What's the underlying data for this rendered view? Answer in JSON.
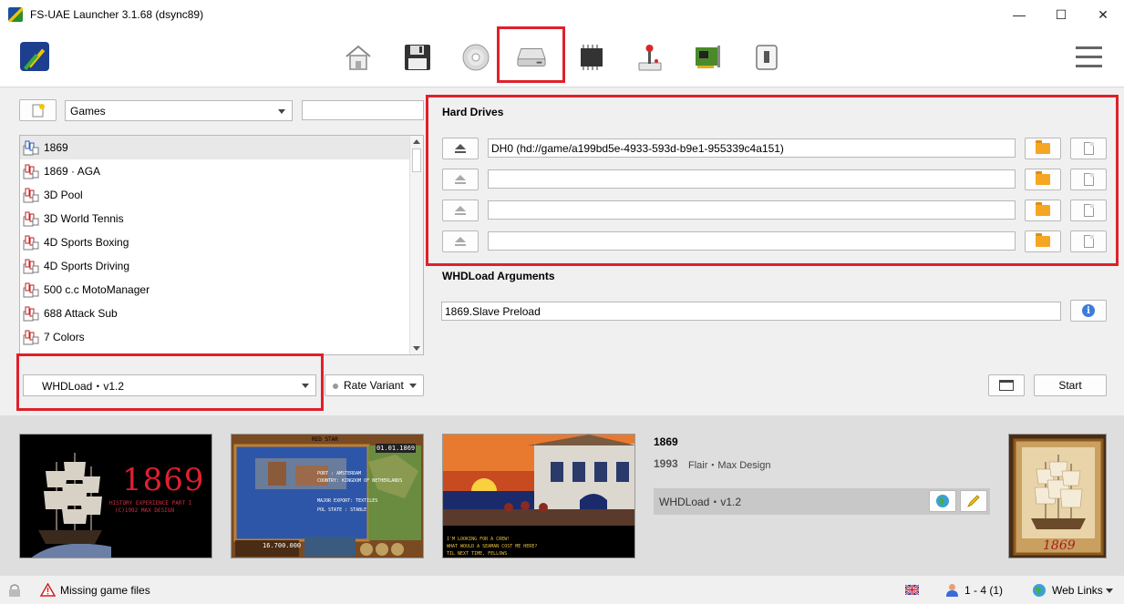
{
  "window": {
    "title": "FS-UAE Launcher 3.1.68 (dsync89)",
    "controls": {
      "minimize": "—",
      "maximize": "☐",
      "close": "✕"
    }
  },
  "toolbar": {
    "tabs": [
      {
        "name": "home-icon"
      },
      {
        "name": "floppy-icon"
      },
      {
        "name": "cdrom-icon"
      },
      {
        "name": "hard-drive-icon",
        "active": true
      },
      {
        "name": "memory-chip-icon"
      },
      {
        "name": "joystick-icon"
      },
      {
        "name": "expansion-card-icon"
      },
      {
        "name": "switch-icon"
      }
    ],
    "menu_icon": "hamburger-menu-icon"
  },
  "left": {
    "database_select": "Games",
    "search_value": "",
    "games": [
      "1869",
      "1869 · AGA",
      "3D Pool",
      "3D World Tennis",
      "4D Sports Boxing",
      "4D Sports Driving",
      "500 c.c MotoManager",
      "688 Attack Sub",
      "7 Colors"
    ],
    "selected_index": 0,
    "variant_select": "WHDLoad・v1.2",
    "rate_variant": "Rate Variant"
  },
  "hard_drives": {
    "title": "Hard Drives",
    "drives": [
      "DH0 (hd://game/a199bd5e-4933-593d-b9e1-955339c4a151)",
      "",
      "",
      ""
    ]
  },
  "whdload": {
    "title": "WHDLoad Arguments",
    "arguments": "1869.Slave Preload",
    "info_glyph": "i"
  },
  "actions": {
    "start": "Start"
  },
  "game_info": {
    "title": "1869",
    "year": "1993",
    "publisher": "Flair・Max Design",
    "variant": "WHDLoad・v1.2"
  },
  "screenshots": {
    "title_screen_title": "1869",
    "title_screen_line1": "HISTORY EXPERIENCE PART I",
    "title_screen_line2": "(C)1992 MAX DESIGN",
    "map_header": "RED STAR",
    "map_date": "01.01.1869",
    "map_port": "PORT : AMSTERDAM",
    "map_country": "COUNTRY: KINGDOM OF NETHERLANDS",
    "map_export": "MAJOR EXPORT: TEXTILES",
    "map_state": "POL STATE : STABLE",
    "map_money": "16.700.000",
    "tavern_text1": "I'M LOOKING FOR A CREW!",
    "tavern_text2": "WHAT WOULD A SEAMAN COST ME HERE?",
    "tavern_text3": "TIL NEXT TIME, FELLOWS",
    "cover_title": "1869"
  },
  "statusbar": {
    "missing": "Missing game files",
    "players": "1 - 4 (1)",
    "web_links": "Web Links"
  },
  "colors": {
    "highlight": "#e0202a",
    "accent_blue": "#3b7dd8"
  }
}
